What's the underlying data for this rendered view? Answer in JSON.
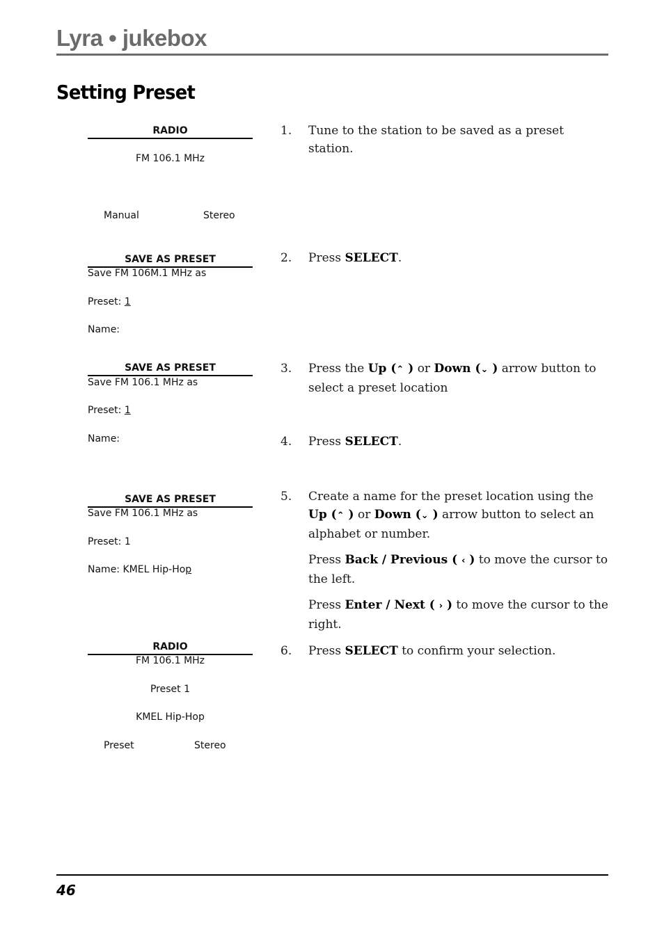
{
  "header": {
    "brand": "Lyra • jukebox",
    "title": "Setting Preset"
  },
  "screens": [
    {
      "heading": "RADIO",
      "lines": [
        "FM 106.1 MHz"
      ],
      "footer_left": "Manual",
      "footer_right": "Stereo"
    },
    {
      "heading": "SAVE AS PRESET",
      "save_line": "Save FM 106M.1 MHz as",
      "preset_label": "Preset: ",
      "preset_value": "1",
      "name_label": "Name:"
    },
    {
      "heading": "SAVE AS PRESET",
      "save_line": "Save FM 106.1 MHz as",
      "preset_label": "Preset: ",
      "preset_value": "1",
      "name_label": "Name:"
    },
    {
      "heading": "SAVE AS PRESET",
      "save_line": "Save FM 106.1 MHz as",
      "preset_line": "Preset: 1",
      "name_label": "Name: ",
      "name_value_prefix": "KMEL Hip-Ho",
      "name_value_cursor": "p"
    },
    {
      "heading": "RADIO",
      "frequency": "FM 106.1 MHz",
      "preset": "Preset 1",
      "station_name": "KMEL Hip-Hop",
      "footer_left": "Preset",
      "footer_right": "Stereo"
    }
  ],
  "steps": {
    "s1": {
      "num": "1.",
      "text": "Tune to the station to be saved as a preset station."
    },
    "s2": {
      "num": "2.",
      "pre": "Press ",
      "bold": "SELECT",
      "post": "."
    },
    "s3": {
      "num": "3.",
      "t1": "Press the ",
      "b1": "Up (",
      "g1": "⌃",
      "b1e": " )",
      "t2": " or ",
      "b2": "Down (",
      "g2": "⌄",
      "b2e": " )",
      "t3": " arrow button to select a preset location"
    },
    "s4": {
      "num": "4.",
      "pre": "Press ",
      "bold": "SELECT",
      "post": "."
    },
    "s5": {
      "num": "5.",
      "t0": "Create a name for the preset location using the ",
      "b1": "Up (",
      "g1": "⌃",
      "b1e": " )",
      "t2": " or ",
      "b2": "Down (",
      "g2": "⌄",
      "b2e": " )",
      "t3": " arrow button to select an alphabet or number.",
      "p2_pre": "Press ",
      "p2_bold": "Back / Previous ( ",
      "p2_glyph": "‹",
      "p2_bold_end": " )",
      "p2_post": "  to move the cursor to the left.",
      "p3_pre": "Press ",
      "p3_bold": "Enter / Next ( ",
      "p3_glyph": "›",
      "p3_bold_end": " )",
      "p3_post": " to  move the cursor to the right."
    },
    "s6": {
      "num": "6.",
      "pre": "Press ",
      "bold": "SELECT",
      "post": " to confirm your selection."
    }
  },
  "footer": {
    "page_number": "46"
  }
}
